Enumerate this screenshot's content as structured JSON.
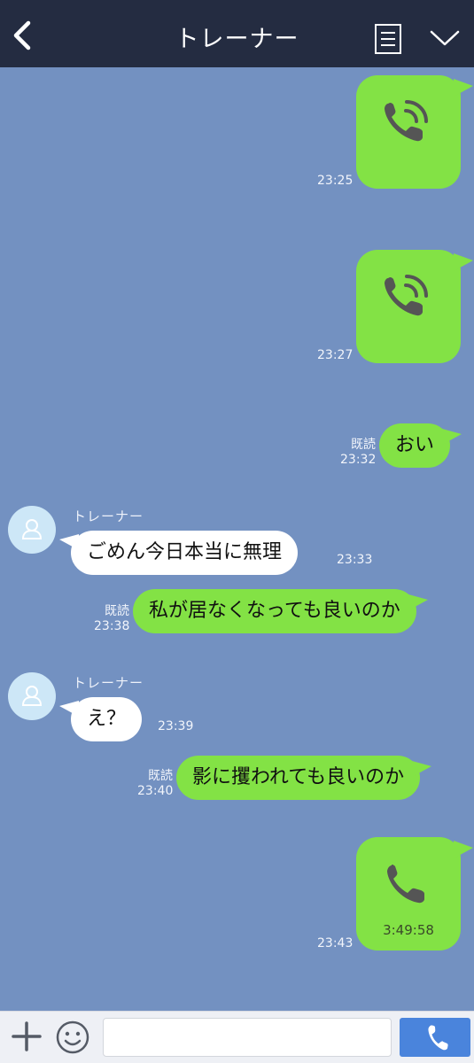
{
  "header": {
    "title": "トレーナー",
    "back_icon": "chevron-left-icon",
    "menu_icon": "list-icon",
    "collapse_icon": "chevron-down-icon",
    "background": "#242c41"
  },
  "chat": {
    "background": "#7391c1",
    "sent_bubble_color": "#83e245",
    "received_bubble_color": "#ffffff",
    "messages": [
      {
        "kind": "call",
        "direction": "sent",
        "icon": "phone-ringing-icon",
        "time": "23:25"
      },
      {
        "kind": "call",
        "direction": "sent",
        "icon": "phone-ringing-icon",
        "time": "23:27"
      },
      {
        "kind": "text",
        "direction": "sent",
        "text": "おい",
        "read": "既読",
        "time": "23:32"
      },
      {
        "kind": "text",
        "direction": "received",
        "sender": "トレーナー",
        "text": "ごめん今日本当に無理",
        "time": "23:33"
      },
      {
        "kind": "text",
        "direction": "sent",
        "text": "私が居なくなっても良いのか",
        "read": "既読",
        "time": "23:38"
      },
      {
        "kind": "text",
        "direction": "received",
        "sender": "トレーナー",
        "text": "え？",
        "time": "23:39"
      },
      {
        "kind": "text",
        "direction": "sent",
        "text": "影に攫われても良いのか",
        "read": "既読",
        "time": "23:40"
      },
      {
        "kind": "call",
        "direction": "sent",
        "icon": "phone-icon",
        "duration": "3:49:58",
        "time": "23:43"
      }
    ]
  },
  "composer": {
    "plus_icon": "plus-icon",
    "emoji_icon": "smiley-icon",
    "input_value": "",
    "call_icon": "phone-icon",
    "call_button_color": "#4a84dc"
  }
}
